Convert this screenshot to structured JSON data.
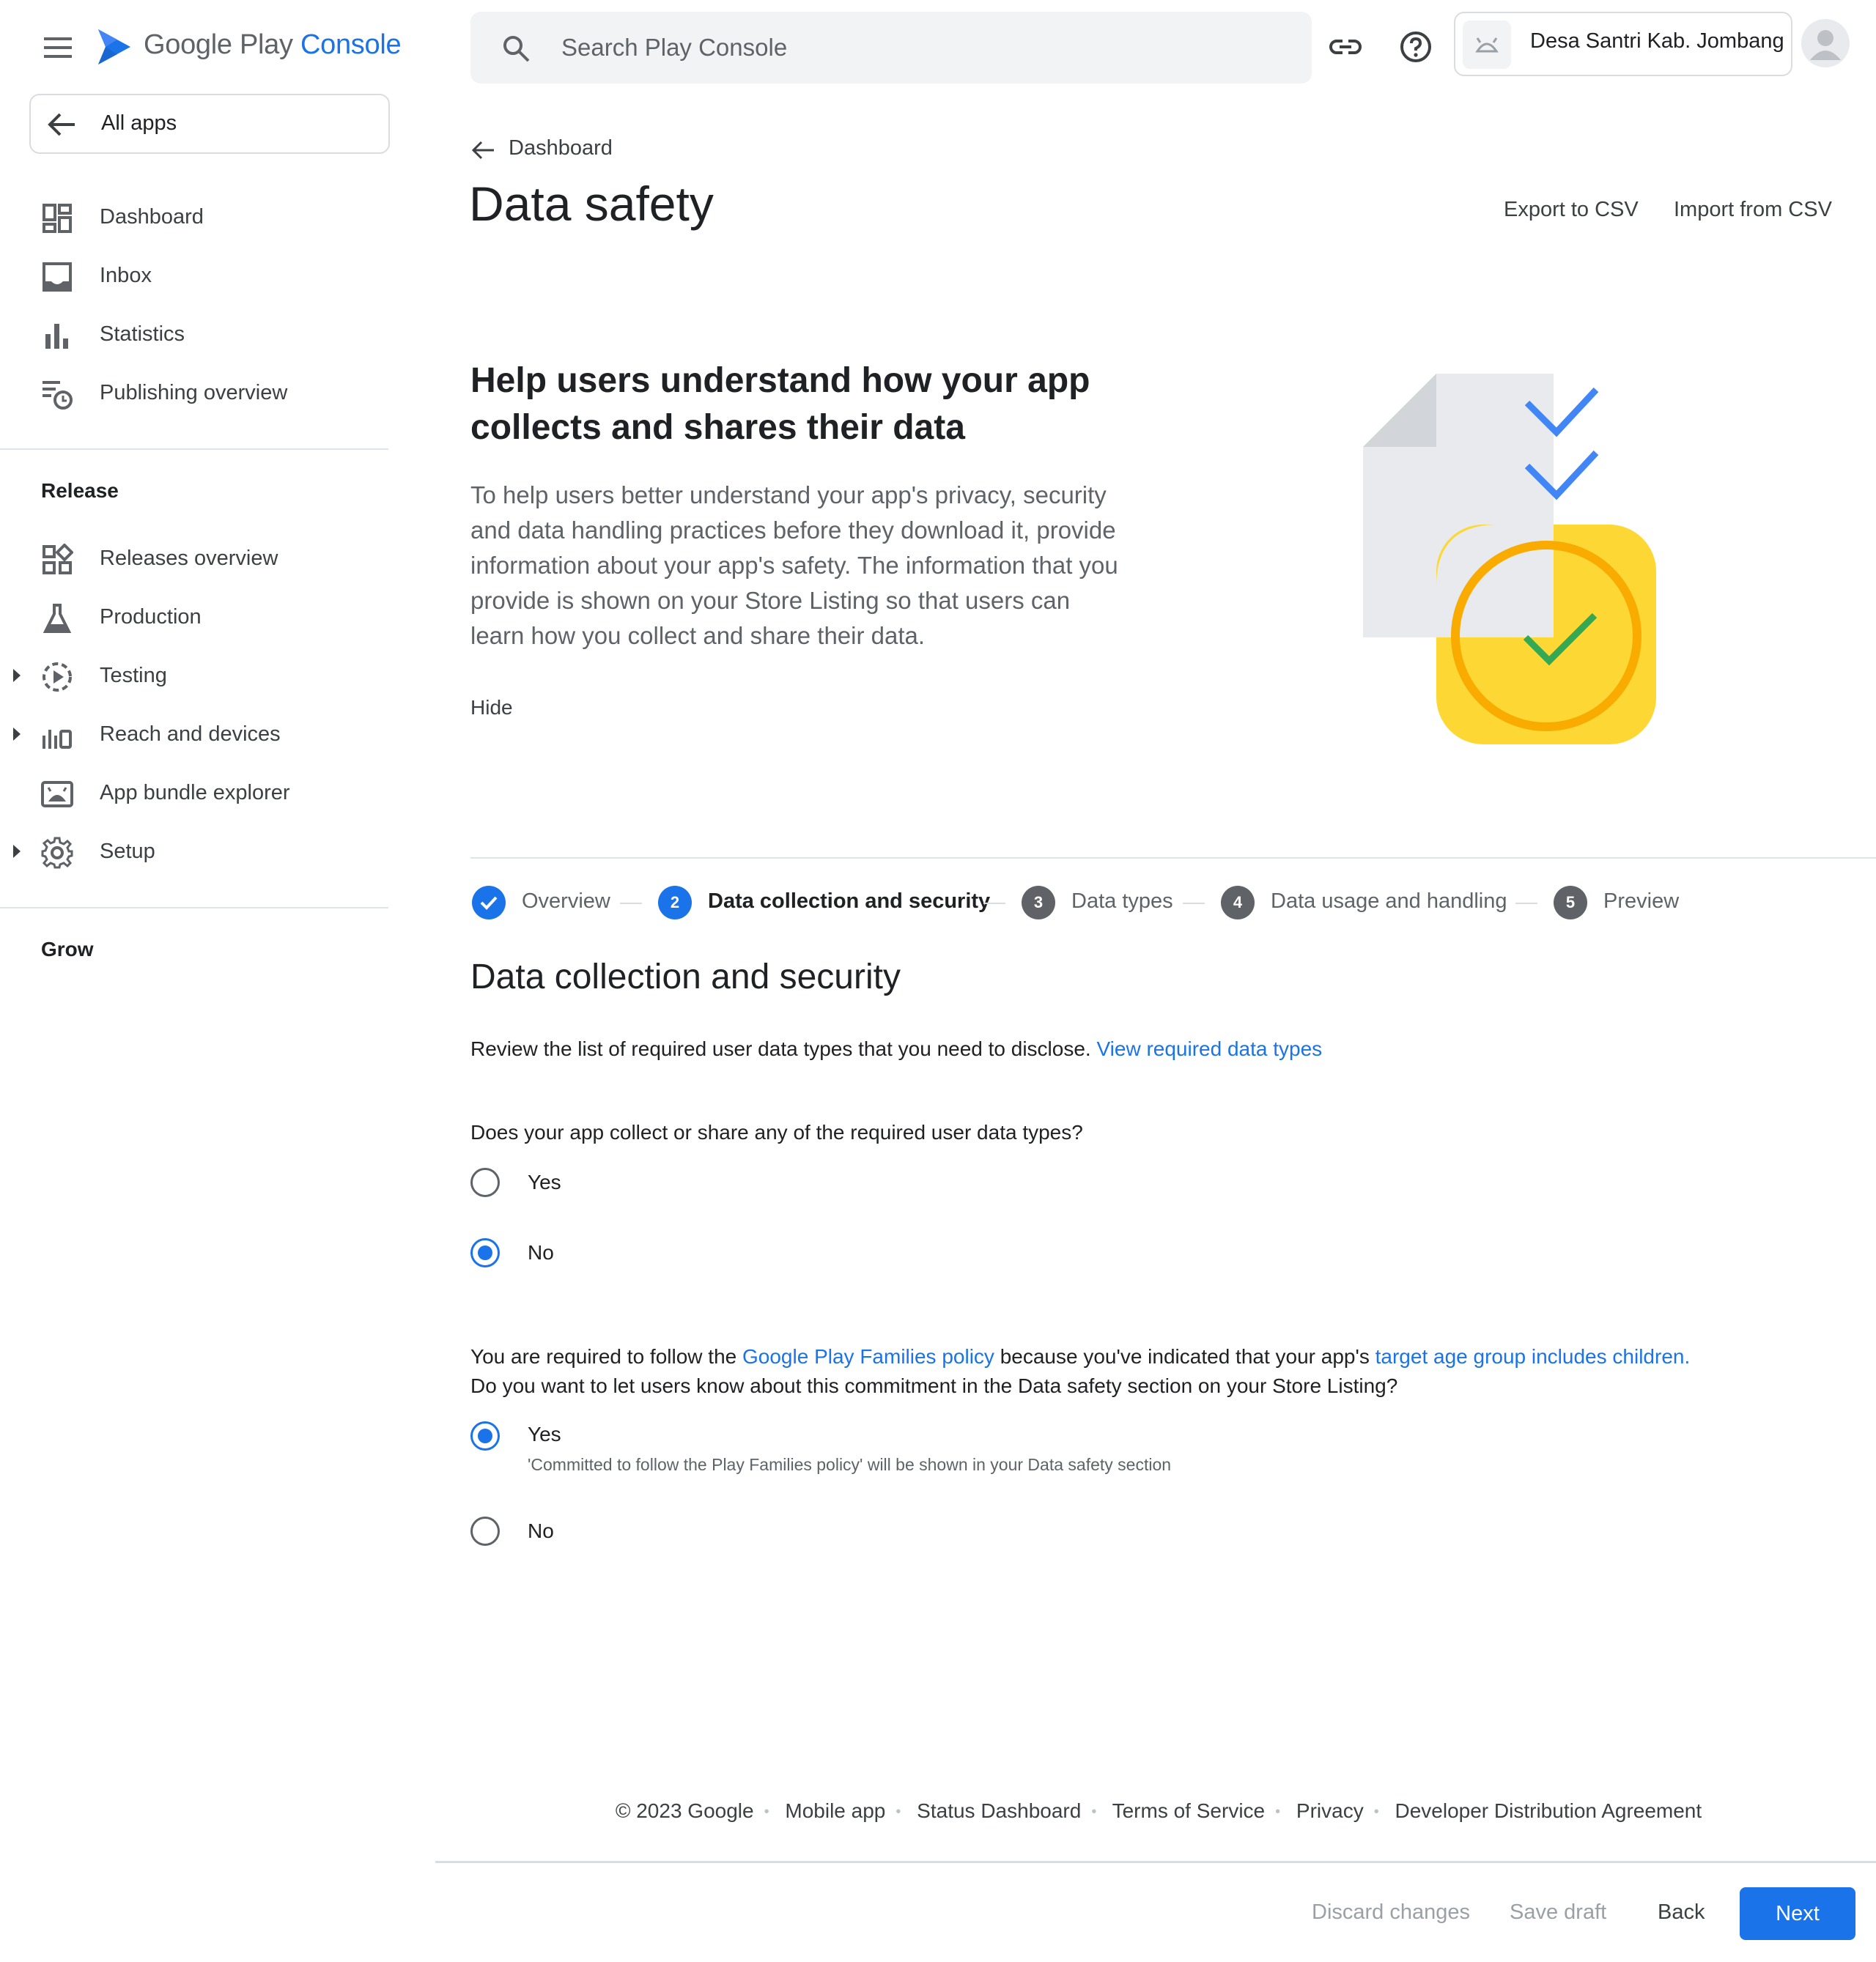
{
  "app": {
    "brand_main": "Google Play",
    "brand_accent": "Console",
    "accent_color": "#1a73e8"
  },
  "sidebar": {
    "all_apps_label": "All apps",
    "main_items": [
      {
        "label": "Dashboard",
        "icon": "dashboard-icon"
      },
      {
        "label": "Inbox",
        "icon": "inbox-icon"
      },
      {
        "label": "Statistics",
        "icon": "bar-chart-icon"
      },
      {
        "label": "Publishing overview",
        "icon": "publishing-icon"
      }
    ],
    "release_heading": "Release",
    "release_items": [
      {
        "label": "Releases overview",
        "icon": "releases-icon"
      },
      {
        "label": "Production",
        "icon": "production-icon"
      },
      {
        "label": "Testing",
        "icon": "testing-icon",
        "expandable": true
      },
      {
        "label": "Reach and devices",
        "icon": "reach-icon",
        "expandable": true
      },
      {
        "label": "App bundle explorer",
        "icon": "android-icon"
      },
      {
        "label": "Setup",
        "icon": "gear-icon",
        "expandable": true
      }
    ],
    "grow_heading": "Grow"
  },
  "topbar": {
    "search_placeholder": "Search Play Console",
    "account_name": "Desa Santri Kab. Jombang"
  },
  "header": {
    "breadcrumb": "Dashboard",
    "title": "Data safety",
    "export_label": "Export to CSV",
    "import_label": "Import from CSV"
  },
  "intro": {
    "title": "Help users understand how your app collects and shares their data",
    "body": "To help users better understand your app's privacy, security and data handling practices before they download it, provide information about your app's safety. The information that you provide is shown on your Store Listing so that users can learn how you collect and share their data.",
    "hide_label": "Hide"
  },
  "stepper": {
    "steps": [
      {
        "num": "1",
        "label": "Overview",
        "state": "done"
      },
      {
        "num": "2",
        "label": "Data collection and security",
        "state": "current"
      },
      {
        "num": "3",
        "label": "Data types",
        "state": "todo"
      },
      {
        "num": "4",
        "label": "Data usage and handling",
        "state": "todo"
      },
      {
        "num": "5",
        "label": "Preview",
        "state": "todo"
      }
    ]
  },
  "form": {
    "section_title": "Data collection and security",
    "review_text": "Review the list of required user data types that you need to disclose.",
    "review_link": "View required data types",
    "q1": {
      "question": "Does your app collect or share any of the required user data types?",
      "options": [
        "Yes",
        "No"
      ],
      "selected": "No"
    },
    "q2": {
      "line1_a": "You are required to follow the",
      "line1_link1": "Google Play Families policy",
      "line1_b": "because you've indicated that your app's",
      "line1_link2": "target age group includes children",
      "line1_c": ".",
      "line2": "Do you want to let users know about this commitment in the Data safety section on your Store Listing?",
      "options": [
        "Yes",
        "No"
      ],
      "yes_sub": "'Committed to follow the Play Families policy' will be shown in your Data safety section",
      "selected": "Yes"
    }
  },
  "footer": {
    "links": [
      "© 2023 Google",
      "Mobile app",
      "Status Dashboard",
      "Terms of Service",
      "Privacy",
      "Developer Distribution Agreement"
    ]
  },
  "actions": {
    "discard": "Discard changes",
    "save": "Save draft",
    "back": "Back",
    "next": "Next"
  }
}
